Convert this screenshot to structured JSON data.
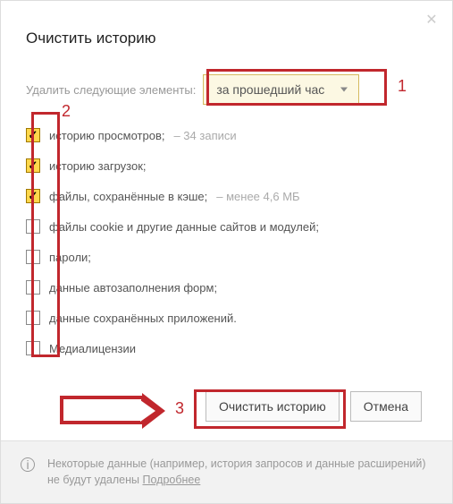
{
  "title": "Очистить историю",
  "periodLabel": "Удалить следующие элементы:",
  "periodSelected": "за прошедший час",
  "callouts": {
    "one": "1",
    "two": "2",
    "three": "3"
  },
  "options": [
    {
      "checked": true,
      "label": "историю просмотров;",
      "extra": "–  34 записи"
    },
    {
      "checked": true,
      "label": "историю загрузок;",
      "extra": ""
    },
    {
      "checked": true,
      "label": "файлы, сохранённые в кэше;",
      "extra": "–  менее 4,6 МБ"
    },
    {
      "checked": false,
      "label": "файлы cookie и другие данные сайтов и модулей;",
      "extra": ""
    },
    {
      "checked": false,
      "label": "пароли;",
      "extra": ""
    },
    {
      "checked": false,
      "label": "данные автозаполнения форм;",
      "extra": ""
    },
    {
      "checked": false,
      "label": "данные сохранённых приложений.",
      "extra": ""
    },
    {
      "checked": false,
      "label": "Медиалицензии",
      "extra": ""
    }
  ],
  "buttons": {
    "clear": "Очистить историю",
    "cancel": "Отмена"
  },
  "footer": {
    "text": "Некоторые данные (например, история запросов и данные расширений) не будут удалены ",
    "link": "Подробнее"
  }
}
